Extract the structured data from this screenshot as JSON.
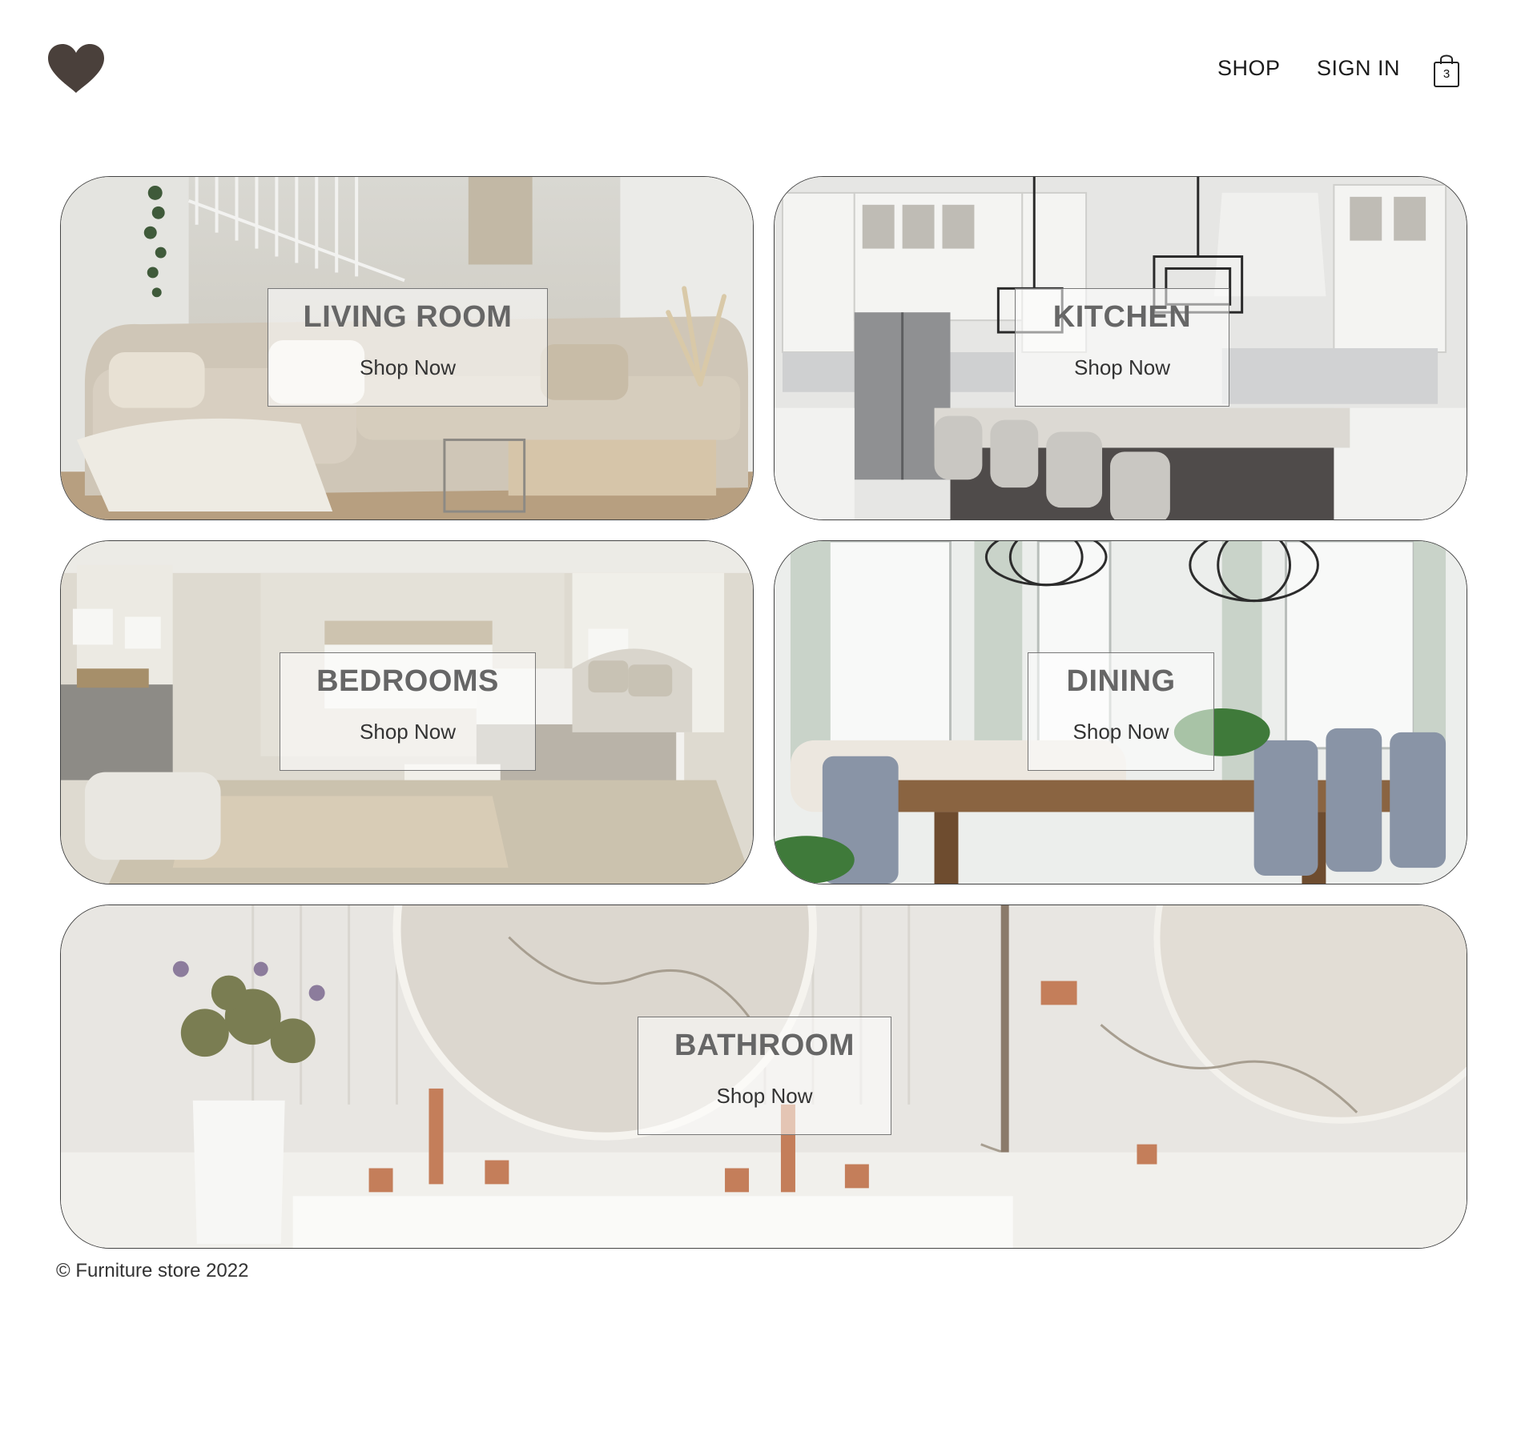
{
  "header": {
    "logo_icon": "heart-icon",
    "nav": {
      "shop_label": "SHOP",
      "signin_label": "SIGN IN"
    },
    "cart": {
      "icon": "shopping-bag-icon",
      "count": "3"
    }
  },
  "categories": [
    {
      "title": "LIVING ROOM",
      "cta": "Shop Now"
    },
    {
      "title": "KITCHEN",
      "cta": "Shop Now"
    },
    {
      "title": "BEDROOMS",
      "cta": "Shop Now"
    },
    {
      "title": "DINING",
      "cta": "Shop Now"
    },
    {
      "title": "BATHROOM",
      "cta": "Shop Now"
    }
  ],
  "footer": {
    "copyright": "© Furniture store 2022"
  },
  "colors": {
    "logo": "#4a403b",
    "label_title": "#666666",
    "card_border": "#444444"
  }
}
